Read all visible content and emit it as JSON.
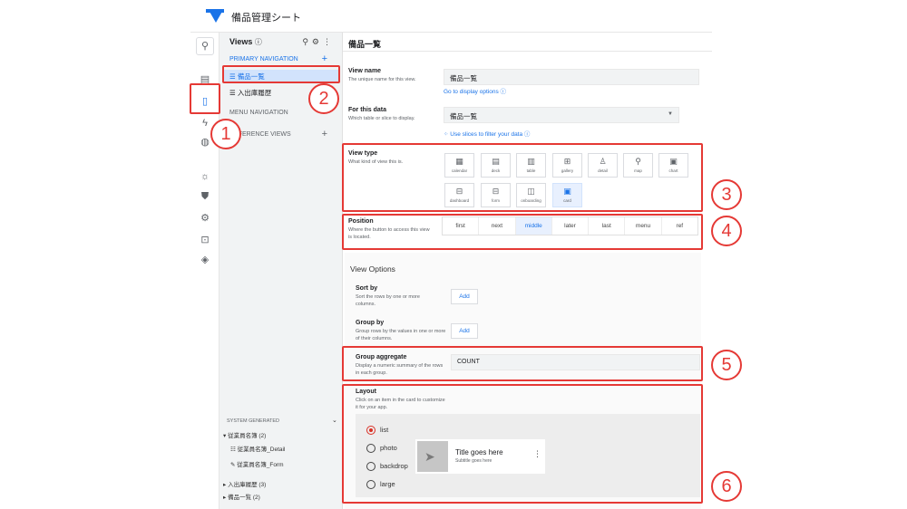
{
  "app": {
    "title": "備品管理シート"
  },
  "views_panel": {
    "header": "Views",
    "info_icon": "ⓘ",
    "primary_navigation": "PRIMARY NAVIGATION",
    "menu_navigation": "MENU NAVIGATION",
    "reference_views": "REFERENCE VIEWS",
    "primary_items": [
      "備品一覧",
      "入出庫履歴"
    ],
    "system_generated": {
      "label": "SYSTEM GENERATED",
      "groups": [
        {
          "label": "従業員名簿 (2)",
          "children": [
            "従業員名簿_Detail",
            "従業員名簿_Form"
          ]
        },
        {
          "label": "入出庫履歴 (3)"
        },
        {
          "label": "備品一覧 (2)"
        }
      ]
    }
  },
  "main": {
    "title": "備品一覧",
    "view_name": {
      "label": "View name",
      "desc": "The unique name for this view.",
      "value": "備品一覧",
      "link": "Go to display options ⓘ"
    },
    "for_this_data": {
      "label": "For this data",
      "desc": "Which table or slice to display.",
      "value": "備品一覧",
      "link": "Use slices to filter your data  ⓘ"
    },
    "view_type": {
      "label": "View type",
      "desc": "What kind of view this is.",
      "options": [
        "calendar",
        "deck",
        "table",
        "gallery",
        "detail",
        "map",
        "chart",
        "dashboard",
        "form",
        "onboarding",
        "card"
      ],
      "selected": "card"
    },
    "position": {
      "label": "Position",
      "desc": "Where the button to access this view is located.",
      "options": [
        "first",
        "next",
        "middle",
        "later",
        "last",
        "menu",
        "ref"
      ],
      "selected": "middle"
    },
    "view_options": {
      "title": "View Options",
      "sort_by": {
        "label": "Sort by",
        "desc": "Sort the rows by one or more columns.",
        "button": "Add"
      },
      "group_by": {
        "label": "Group by",
        "desc": "Group rows by the values in one or more of their columns.",
        "button": "Add"
      },
      "group_aggregate": {
        "label": "Group aggregate",
        "desc": "Display a numeric summary of the rows in each group.",
        "value": "COUNT"
      },
      "layout": {
        "label": "Layout",
        "desc": "Click on an item in the card to customize it for your app.",
        "options": [
          "list",
          "photo",
          "backdrop",
          "large"
        ],
        "selected": "list",
        "card_title": "Title goes here",
        "card_subtitle": "Subtitle goes here"
      }
    }
  },
  "annotations": [
    "1",
    "2",
    "3",
    "4",
    "5",
    "6"
  ],
  "colors": {
    "accent": "#1a73e8",
    "annotation": "#e53935",
    "selected_bg": "#e8f0fe"
  }
}
